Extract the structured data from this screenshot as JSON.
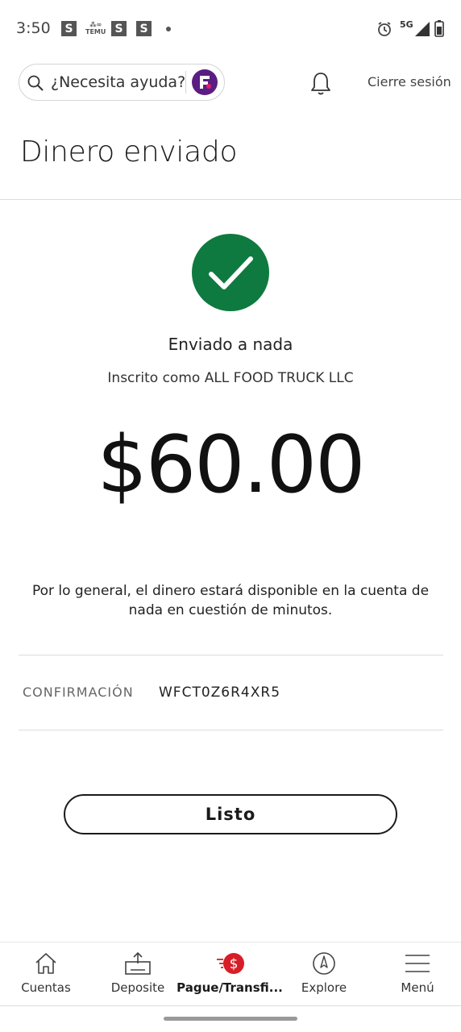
{
  "status_bar": {
    "time": "3:50",
    "notif_1": "S",
    "notif_temu": "TEMU",
    "notif_2": "S",
    "notif_3": "S",
    "network": "5G"
  },
  "header": {
    "search_placeholder": "¿Necesita ayuda?",
    "logout_label": "Cierre sesión"
  },
  "page": {
    "title": "Dinero enviado"
  },
  "confirmation": {
    "sent_to": "Enviado a nada",
    "enrolled_as": "Inscrito como ALL FOOD TRUCK LLC",
    "amount": "$60.00",
    "note": "Por lo general, el dinero estará disponible en la cuenta de nada en cuestión de minutos.",
    "label": "CONFIRMACIÓN",
    "code": "WFCT0Z6R4XR5",
    "done_label": "Listo"
  },
  "bottom_nav": {
    "items": [
      {
        "label": "Cuentas",
        "icon": "home-icon",
        "active": false
      },
      {
        "label": "Deposite",
        "icon": "deposit-icon",
        "active": false
      },
      {
        "label": "Pague/Transfi...",
        "icon": "pay-transfer-icon",
        "active": true
      },
      {
        "label": "Explore",
        "icon": "compass-icon",
        "active": false
      },
      {
        "label": "Menú",
        "icon": "menu-icon",
        "active": false
      }
    ]
  },
  "colors": {
    "success": "#0e7a3f",
    "accent_red": "#d71e28",
    "fargo_purple": "#5a1d82"
  }
}
